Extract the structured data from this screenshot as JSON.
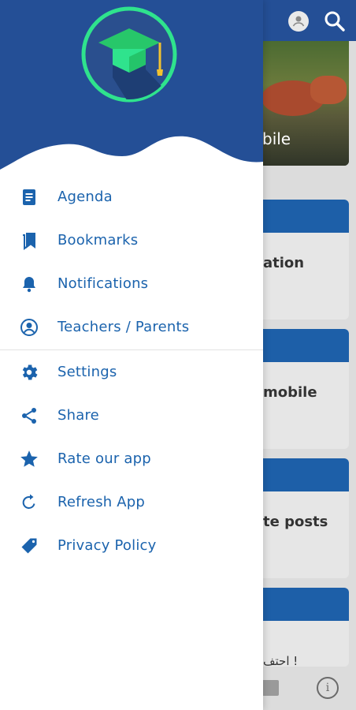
{
  "background": {
    "hero_caption": "bile",
    "cards": [
      {
        "text": "ation"
      },
      {
        "text": "mobile"
      },
      {
        "text": "te posts"
      },
      {
        "text": "احتف !"
      }
    ],
    "info_symbol": "i"
  },
  "drawer": {
    "menu": [
      {
        "label": "Agenda",
        "icon": "agenda-icon"
      },
      {
        "label": "Bookmarks",
        "icon": "bookmark-icon"
      },
      {
        "label": "Notifications",
        "icon": "bell-icon"
      },
      {
        "label": "Teachers / Parents",
        "icon": "account-circle-icon"
      },
      {
        "label": "Settings",
        "icon": "gear-icon"
      },
      {
        "label": "Share",
        "icon": "share-icon"
      },
      {
        "label": "Rate our app",
        "icon": "star-icon"
      },
      {
        "label": "Refresh App",
        "icon": "refresh-icon"
      },
      {
        "label": "Privacy Policy",
        "icon": "tag-icon"
      }
    ]
  },
  "colors": {
    "primary": "#244f96",
    "accent_green": "#2fe38d",
    "menu_text": "#1b63ad",
    "card_band": "#1d5fa8"
  }
}
